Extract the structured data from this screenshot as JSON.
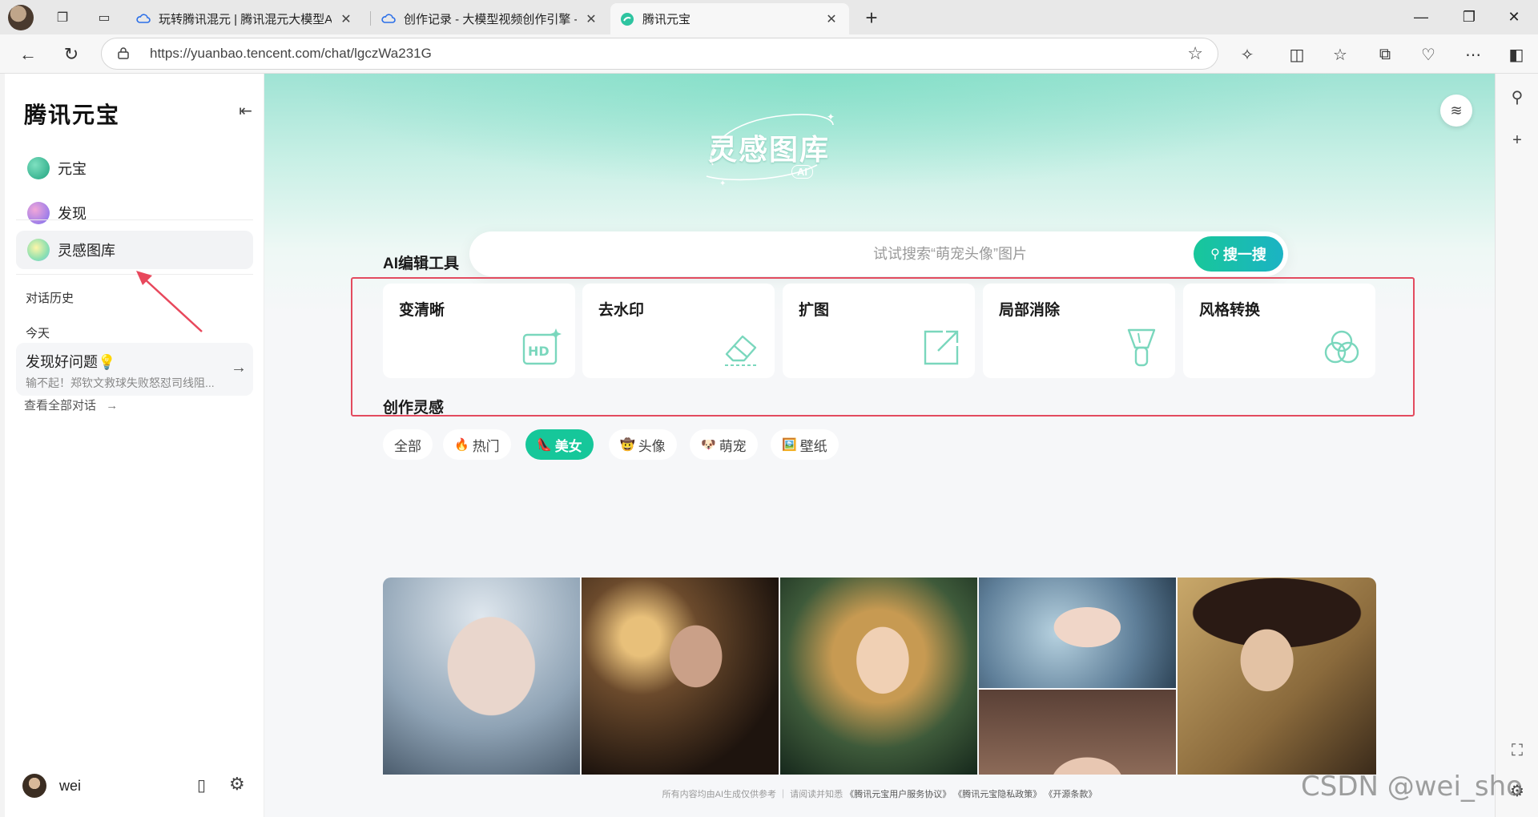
{
  "browser": {
    "tabs": [
      {
        "title": "玩转腾讯混元 | 腾讯混元大模型AI",
        "active": false
      },
      {
        "title": "创作记录 - 大模型视频创作引擎 -",
        "active": false
      },
      {
        "title": "腾讯元宝",
        "active": true
      }
    ],
    "url": "https://yuanbao.tencent.com/chat/lgczWa231G"
  },
  "sidebar": {
    "brand": "腾讯元宝",
    "nav": [
      {
        "label": "元宝"
      },
      {
        "label": "发现"
      },
      {
        "label": "灵感图库"
      }
    ],
    "history_label": "对话历史",
    "today_label": "今天",
    "history_item": {
      "title": "发现好问题💡",
      "subtitle": "输不起！郑钦文救球失败怒怼司线阻..."
    },
    "view_all": "查看全部对话",
    "user": {
      "name": "wei"
    }
  },
  "main": {
    "hero_title": "灵感图库",
    "hero_badge": "AI",
    "search": {
      "placeholder": "试试搜索“萌宠头像”图片",
      "button": "搜一搜"
    },
    "tools_title": "AI编辑工具",
    "tools": [
      {
        "label": "变清晰",
        "icon": "hd-icon"
      },
      {
        "label": "去水印",
        "icon": "eraser-icon"
      },
      {
        "label": "扩图",
        "icon": "expand-icon"
      },
      {
        "label": "局部消除",
        "icon": "brush-icon"
      },
      {
        "label": "风格转换",
        "icon": "circles-icon"
      }
    ],
    "inspiration_title": "创作灵感",
    "chips": [
      {
        "emoji": "",
        "label": "全部",
        "active": false
      },
      {
        "emoji": "🔥",
        "label": "热门",
        "active": false
      },
      {
        "emoji": "👠",
        "label": "美女",
        "active": true
      },
      {
        "emoji": "🤠",
        "label": "头像",
        "active": false
      },
      {
        "emoji": "🐶",
        "label": "萌宠",
        "active": false
      },
      {
        "emoji": "🖼️",
        "label": "壁纸",
        "active": false
      }
    ],
    "footer": {
      "prefix": "所有内容均由AI生成仅供参考 ｜ 请阅读并知悉",
      "links": [
        "《腾讯元宝用户服务协议》",
        "《腾讯元宝隐私政策》",
        "《开源条款》"
      ]
    }
  },
  "watermark": "CSDN @wei_sho",
  "colors": {
    "accent": "#16c79a",
    "highlight": "#e34b5f"
  }
}
